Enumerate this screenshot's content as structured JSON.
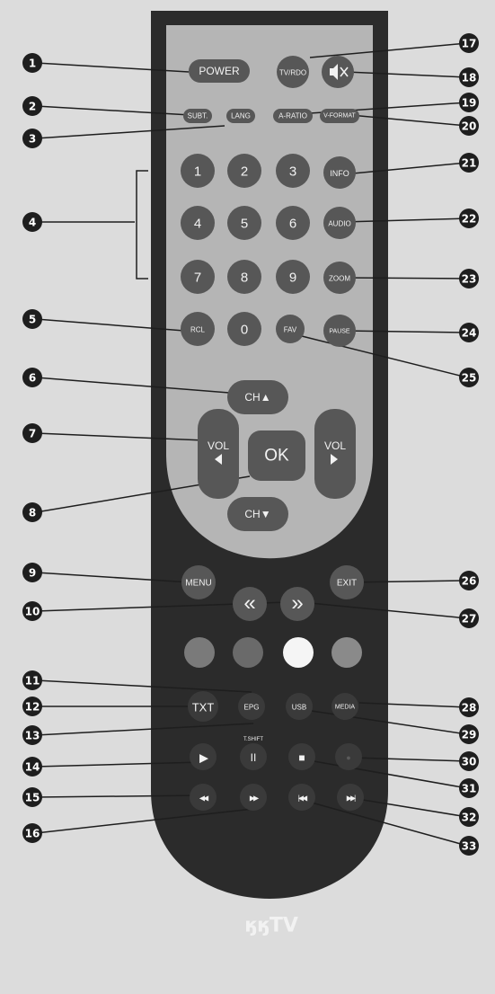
{
  "buttons": {
    "power": "POWER",
    "subt": "SUBT.",
    "lang": "LANG",
    "tv_rdo": "TV/RDO",
    "a_ratio": "A-RATIO",
    "v_format": "V-FORMAT",
    "digits": [
      "1",
      "2",
      "3",
      "4",
      "5",
      "6",
      "7",
      "8",
      "9",
      "0"
    ],
    "info": "INFO",
    "audio": "AUDIO",
    "zoom": "ZOOM",
    "rcl": "RCL",
    "fav": "FAV",
    "pause": "PAUSE",
    "ch_up": "CH▲",
    "ch_down": "CH▼",
    "vol_left": "VOL",
    "vol_right": "VOL",
    "ok": "OK",
    "menu": "MENU",
    "exit": "EXIT",
    "page_left": "«",
    "page_right": "»",
    "txt": "TXT",
    "epg": "EPG",
    "usb": "USB",
    "media": "MEDIA",
    "timeshift": "T.SHIFT",
    "play": "▶",
    "pause_sym": "II",
    "stop": "■",
    "rec": "●",
    "rew": "◀◀",
    "ff": "▶▶",
    "prev": "|◀◀",
    "next": "▶▶|"
  },
  "brand": "ӄӄTV",
  "callouts_left": [
    "1",
    "2",
    "3",
    "4",
    "5",
    "6",
    "7",
    "8",
    "9",
    "10",
    "11",
    "12",
    "13",
    "14",
    "15",
    "16"
  ],
  "callouts_right": [
    "17",
    "18",
    "19",
    "20",
    "21",
    "22",
    "23",
    "24",
    "25",
    "26",
    "27",
    "28",
    "29",
    "30",
    "31",
    "32",
    "33"
  ],
  "colors": {
    "background": "#dcdcdc",
    "body": "#2b2b2b",
    "panel": "#b5b5b5",
    "button_dark": "#575757",
    "red": "#7a7a7a",
    "green": "#6a6a6a",
    "yellow": "#f5f5f5",
    "blue": "#8a8a8a",
    "callout": "#1e1e1e"
  }
}
